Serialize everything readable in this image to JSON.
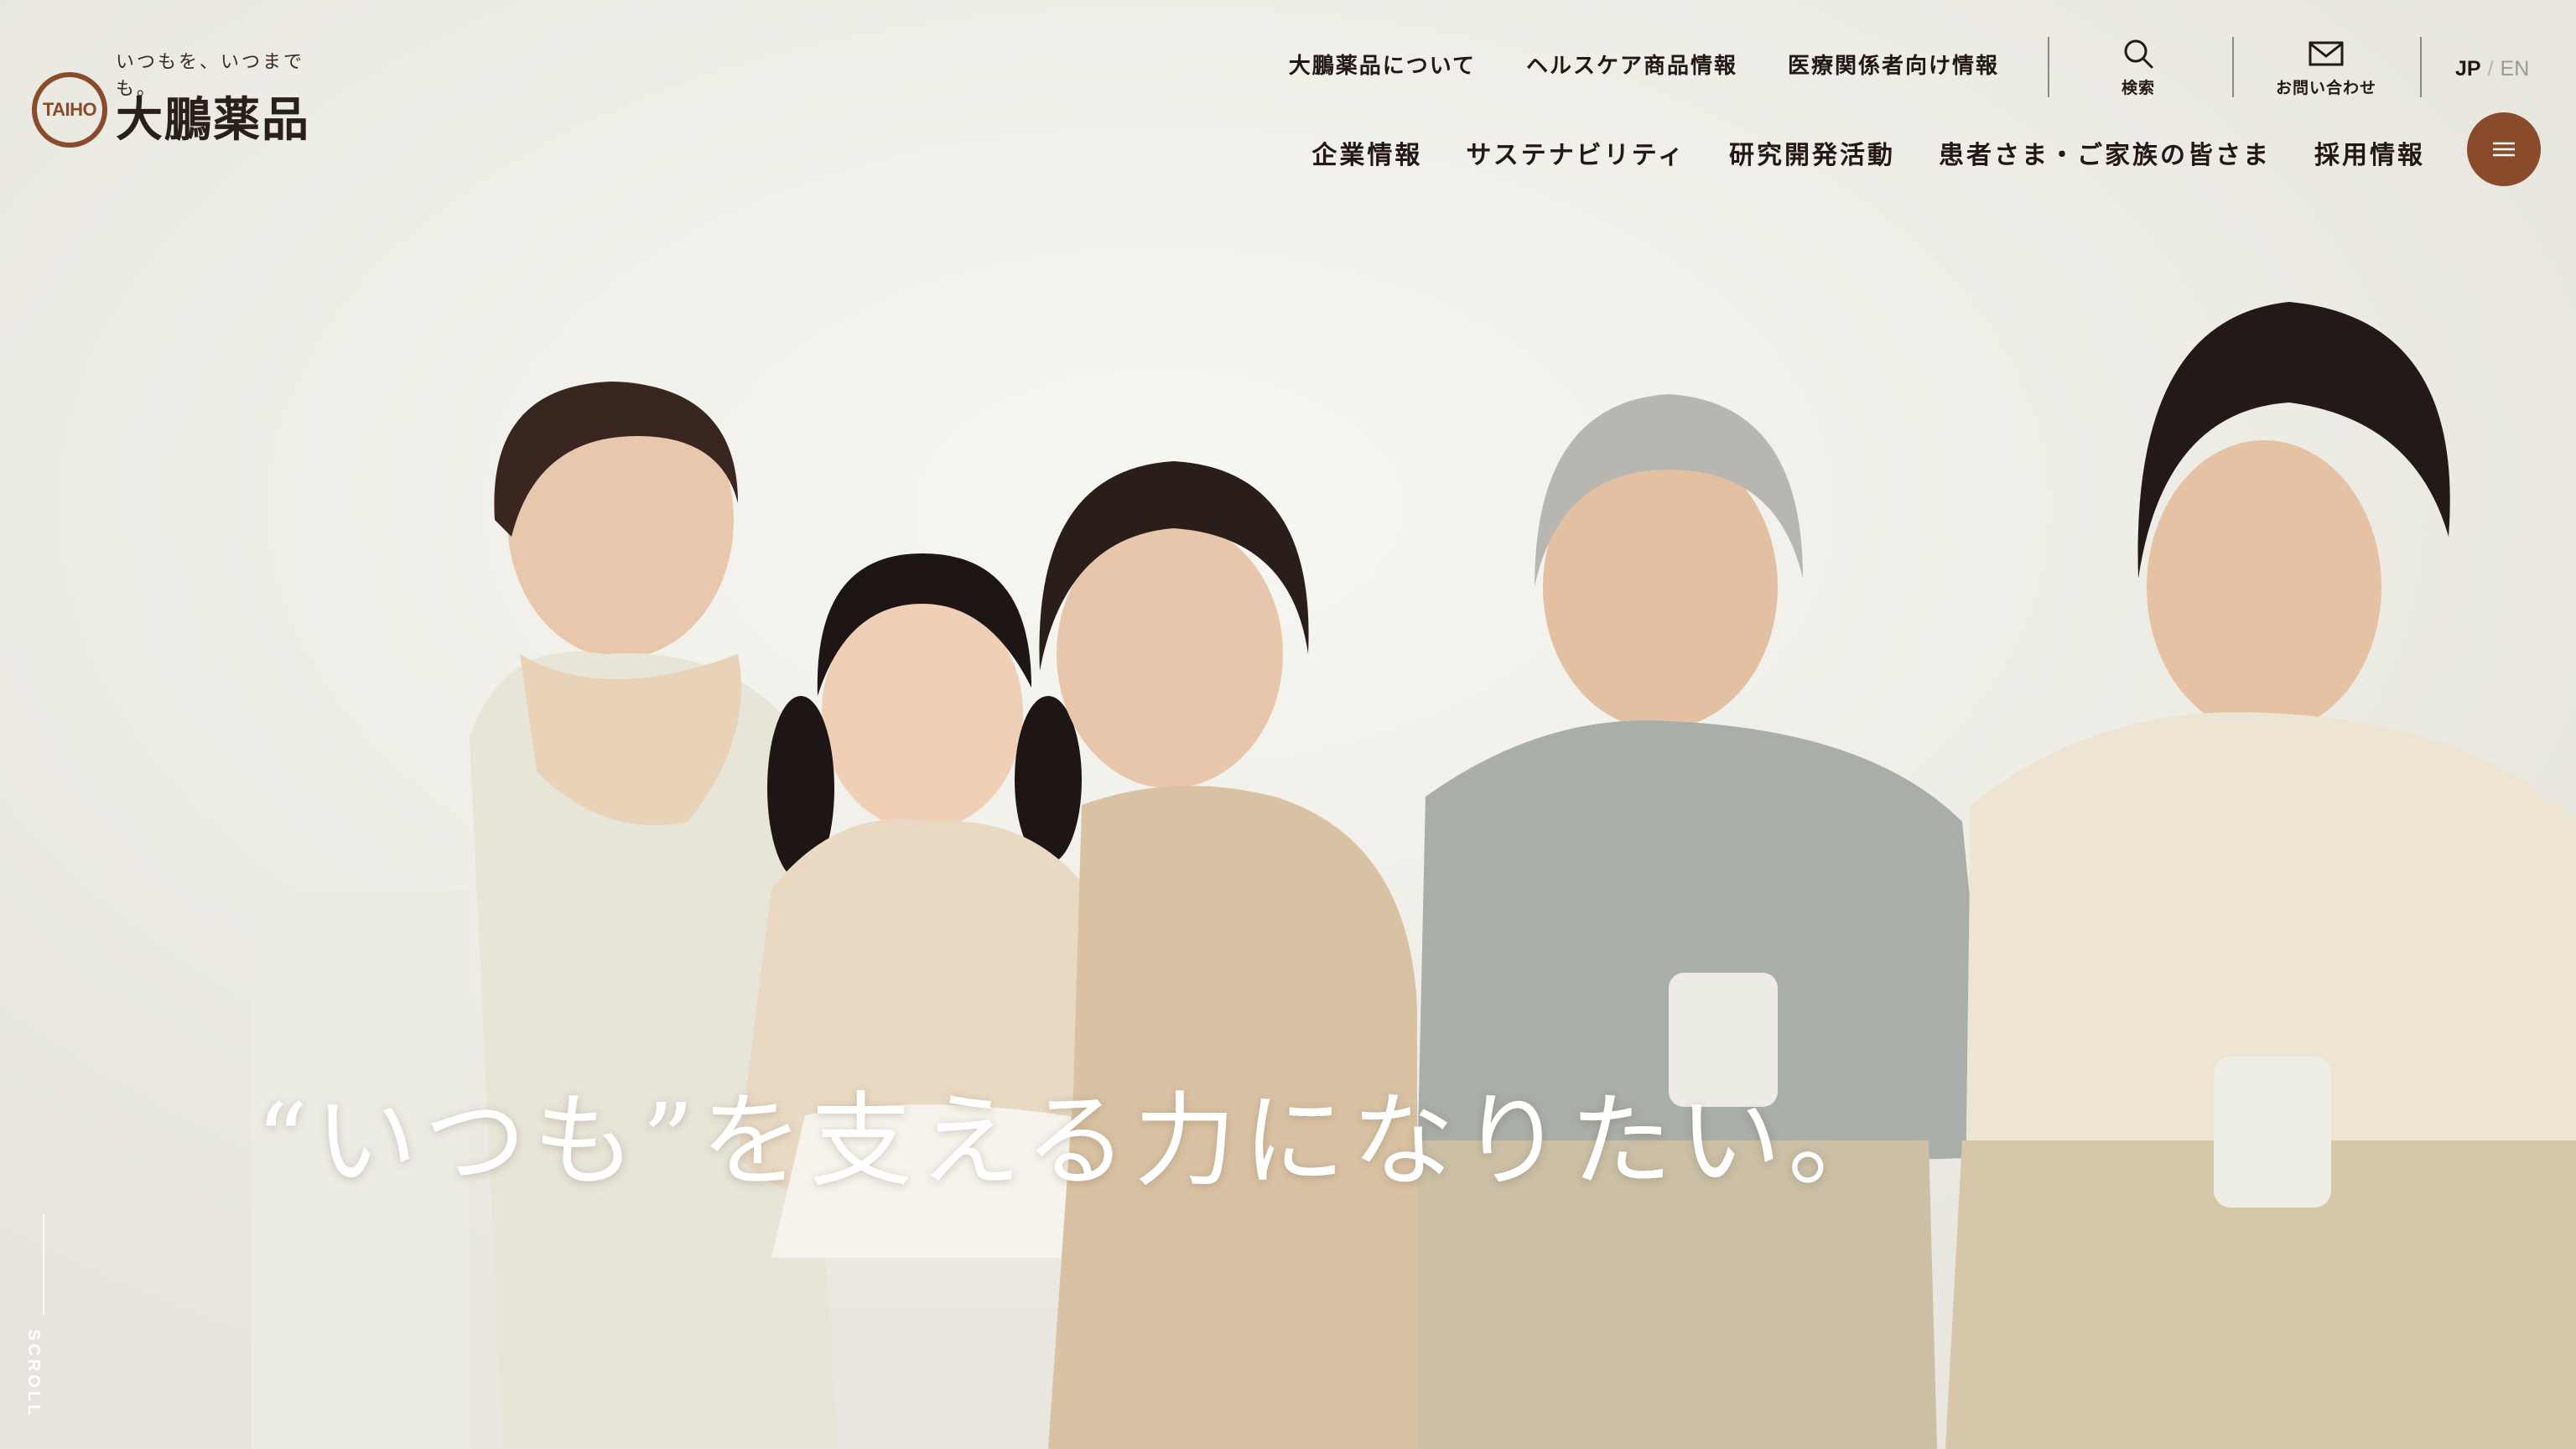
{
  "logo": {
    "tagline": "いつもを、いつまでも。",
    "mark_text": "TAIHO",
    "company_name": "大鵬薬品"
  },
  "utility_nav": {
    "items": [
      {
        "label": "大鵬薬品について"
      },
      {
        "label": "ヘルスケア商品情報"
      },
      {
        "label": "医療関係者向け情報"
      }
    ],
    "search_label": "検索",
    "contact_label": "お問い合わせ"
  },
  "language": {
    "current": "JP",
    "separator": "/",
    "other": "EN"
  },
  "main_nav": {
    "items": [
      {
        "label": "企業情報"
      },
      {
        "label": "サステナビリティ"
      },
      {
        "label": "研究開発活動"
      },
      {
        "label": "患者さま・ご家族の皆さま"
      },
      {
        "label": "採用情報"
      }
    ]
  },
  "hero": {
    "catch_copy": "“いつも”を支える力になりたい。",
    "scroll_label": "SCROLL"
  },
  "colors": {
    "brand": "#8a4a2c",
    "text": "#231815",
    "background": "#f0f0ea"
  },
  "icons": {
    "search": "search-icon",
    "contact": "mail-icon",
    "menu": "hamburger-menu-icon"
  }
}
